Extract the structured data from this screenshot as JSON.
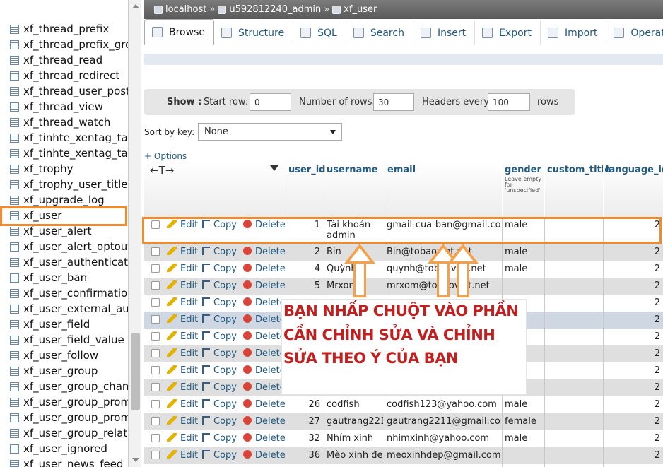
{
  "sidebar": {
    "tables": [
      "xf_thread_prefix",
      "xf_thread_prefix_gro",
      "xf_thread_read",
      "xf_thread_redirect",
      "xf_thread_user_post",
      "xf_thread_view",
      "xf_thread_watch",
      "xf_tinhte_xentag_tag",
      "xf_tinhte_xentag_tag",
      "xf_trophy",
      "xf_trophy_user_title",
      "xf_upgrade_log",
      "xf_user",
      "xf_user_alert",
      "xf_user_alert_optout",
      "xf_user_authenticate",
      "xf_user_ban",
      "xf_user_confirmation",
      "xf_user_external_aut",
      "xf_user_field",
      "xf_user_field_value",
      "xf_user_follow",
      "xf_user_group",
      "xf_user_group_chang",
      "xf_user_group_prom",
      "xf_user_group_prom",
      "xf_user_group_relatio",
      "xf_user_ignored",
      "xf_user_news_feed"
    ],
    "selected": "xf_user"
  },
  "breadcrumb": {
    "server": "localhost",
    "database": "u592812240_admin",
    "table": "xf_user",
    "separator": "»"
  },
  "tabs": [
    "Browse",
    "Structure",
    "SQL",
    "Search",
    "Insert",
    "Export",
    "Import",
    "Operations"
  ],
  "navigation": {
    "show_label": "Show :",
    "start_row_label": "Start row:",
    "start_row_value": "0",
    "num_rows_label": "Number of rows:",
    "num_rows_value": "30",
    "headers_every_label": "Headers every",
    "headers_every_value": "100",
    "rows_label": "rows"
  },
  "sort": {
    "label": "Sort by key:",
    "value": "None"
  },
  "options_link": "+ Options",
  "table": {
    "sort_arrows": "←T→",
    "columns": [
      "user_id",
      "username",
      "email",
      "gender",
      "custom_title",
      "language_id"
    ],
    "gender_note": "Leave empty for 'unspecified'",
    "actions": {
      "edit": "Edit",
      "copy": "Copy",
      "delete": "Delete"
    },
    "rows": [
      {
        "user_id": "1",
        "username": "Tài khoản admin",
        "email": "gmail-cua-ban@gmail.com",
        "gender": "male",
        "language_id": "2"
      },
      {
        "user_id": "2",
        "username": "Bin",
        "email": "Bin@tobaoviet.net",
        "gender": "male",
        "language_id": "2"
      },
      {
        "user_id": "4",
        "username": "Quỳnh",
        "email": "quynh@tobaoviet.net",
        "gender": "male",
        "language_id": "2"
      },
      {
        "user_id": "5",
        "username": "Mrxom",
        "email": "mrxom@tobaoviet.net",
        "gender": "",
        "language_id": "2"
      },
      {
        "user_id": "",
        "username": "",
        "email": "",
        "gender": "",
        "language_id": "2"
      },
      {
        "user_id": "",
        "username": "",
        "email": "",
        "gender": "",
        "language_id": "2"
      },
      {
        "user_id": "",
        "username": "",
        "email": "",
        "gender": "",
        "language_id": "2"
      },
      {
        "user_id": "",
        "username": "",
        "email": "",
        "gender": "",
        "language_id": "2"
      },
      {
        "user_id": "",
        "username": "",
        "email": "",
        "gender": "",
        "language_id": "2"
      },
      {
        "user_id": "",
        "username": "",
        "email": "",
        "gender": "",
        "language_id": "2"
      },
      {
        "user_id": "26",
        "username": "codfish",
        "email": "codfish123@yahoo.com",
        "gender": "male",
        "language_id": "2"
      },
      {
        "user_id": "27",
        "username": "gautrang2211",
        "email": "gautrang2211@gmail.com",
        "gender": "female",
        "language_id": "2"
      },
      {
        "user_id": "32",
        "username": "Nhím xinh",
        "email": "nhimxinh@yahoo.com",
        "gender": "male",
        "language_id": "2"
      },
      {
        "user_id": "36",
        "username": "Mèo xinh đẹp",
        "email": "meoxinhdep@gmail.com",
        "gender": "",
        "language_id": "2"
      }
    ]
  },
  "callout": {
    "lines": [
      "BẠN NHẤP CHUỘT VÀO PHẦN",
      "CẦN CHỈNH SỬA VÀ CHỈNH",
      "SỬA THEO Ý CỦA BẠN"
    ],
    "color": "#c02020"
  },
  "colors": {
    "highlight": "#f28a2c",
    "link": "#235a81"
  }
}
